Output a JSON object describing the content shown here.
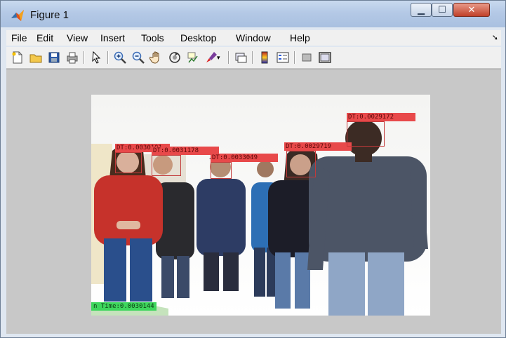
{
  "window": {
    "title": "Figure 1"
  },
  "menu": {
    "items": [
      {
        "label": "File"
      },
      {
        "label": "Edit"
      },
      {
        "label": "View"
      },
      {
        "label": "Insert"
      },
      {
        "label": "Tools"
      },
      {
        "label": "Desktop"
      },
      {
        "label": "Window"
      },
      {
        "label": "Help"
      }
    ]
  },
  "toolbar": {
    "buttons": [
      "new-figure",
      "open-file",
      "save",
      "print",
      "edit-plot",
      "zoom-in",
      "zoom-out",
      "pan",
      "rotate-3d",
      "data-cursor",
      "brush",
      "link-plot",
      "insert-colorbar",
      "insert-legend",
      "hide-plot-tools",
      "show-plot-tools"
    ]
  },
  "figure": {
    "detections": [
      {
        "label": "DT:0.0030101"
      },
      {
        "label": "DT:0.0031178"
      },
      {
        "label": "DT:0.0033049"
      },
      {
        "label": "DT:0.0029719"
      },
      {
        "label": "DT:0.0029172"
      }
    ],
    "time_label": "n Time:0.0030144",
    "colors": {
      "detection": "#e8494a",
      "time": "#3ed65d"
    }
  }
}
